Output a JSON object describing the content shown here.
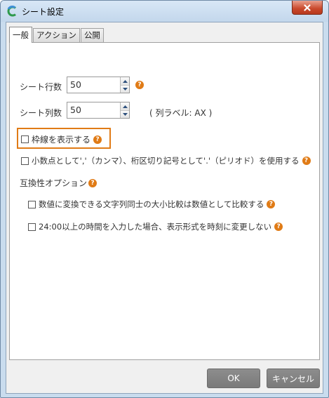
{
  "window": {
    "title": "シート設定"
  },
  "tabs": [
    {
      "label": "一般",
      "active": true
    },
    {
      "label": "アクション",
      "active": false
    },
    {
      "label": "公開",
      "active": false
    }
  ],
  "general": {
    "rows": {
      "label": "シート行数",
      "value": "50"
    },
    "cols": {
      "label": "シート列数",
      "value": "50",
      "note": "( 列ラベル: AX )"
    },
    "gridlines": {
      "label": "枠線を表示する",
      "checked": false
    },
    "separator": {
      "label": "小数点として','（カンマ）、桁区切り記号として'.'（ピリオド）を使用する",
      "checked": false
    },
    "compat": {
      "heading": "互換性オプション",
      "compare_numeric": {
        "label": "数値に変換できる文字列同士の大小比較は数値として比較する",
        "checked": false
      },
      "time_24": {
        "label": "24:00以上の時間を入力した場合、表示形式を時刻に変更しない",
        "checked": false
      }
    }
  },
  "help_glyph": "?",
  "buttons": {
    "ok": "OK",
    "cancel": "キャンセル"
  },
  "colors": {
    "accent": "#e07b16",
    "button": "#808080",
    "titlebar": "#c9dcee"
  }
}
